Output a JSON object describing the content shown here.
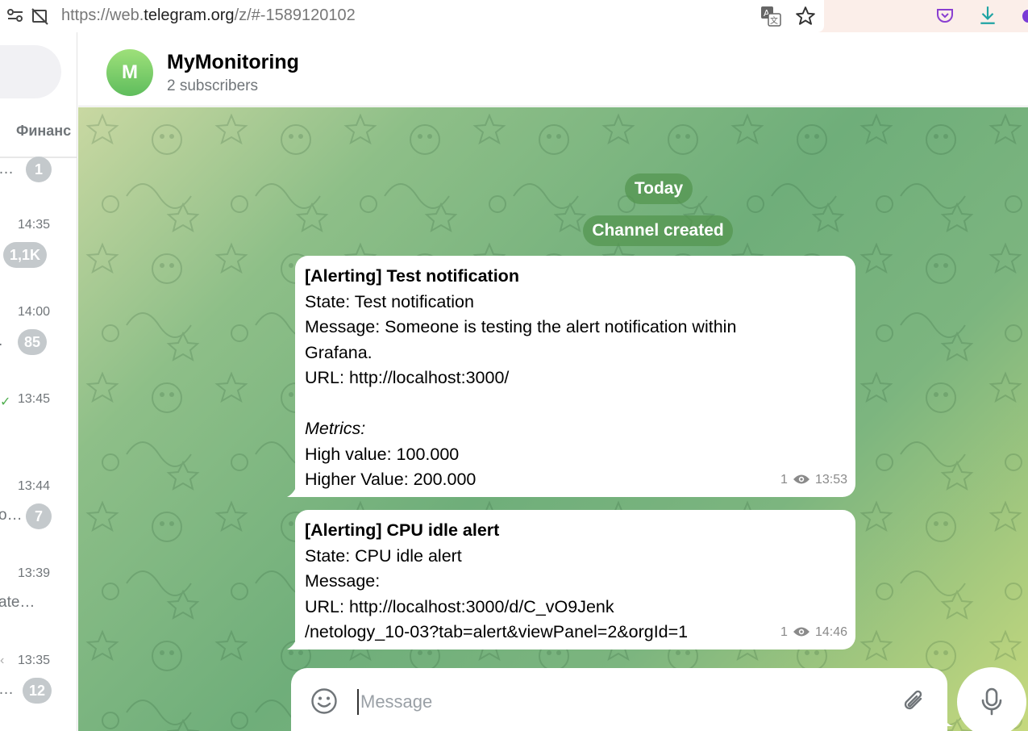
{
  "browser": {
    "url_prefix": "https://web.",
    "url_domain": "telegram.org",
    "url_path": "/z/#-1589120102"
  },
  "sidebar": {
    "folder_label": "Финанс",
    "items": [
      {
        "time": "",
        "snippet": "…",
        "badge": "1",
        "check": ""
      },
      {
        "time": "14:35",
        "snippet": "",
        "badge": "1,1K",
        "check": ""
      },
      {
        "time": "14:00",
        "snippet": ".",
        "badge": "85",
        "check": ""
      },
      {
        "time": "13:45",
        "snippet": "",
        "badge": "",
        "check": "✓"
      },
      {
        "time": "13:44",
        "snippet": "o…",
        "badge": "7",
        "check": ""
      },
      {
        "time": "13:39",
        "snippet": "ate…",
        "badge": "",
        "check": ""
      },
      {
        "time": "13:35",
        "snippet": "…",
        "badge": "12",
        "check": "‹"
      }
    ]
  },
  "header": {
    "avatar_letter": "M",
    "title": "MyMonitoring",
    "subtitle": "2 subscribers"
  },
  "chat": {
    "date_pill": "Today",
    "service_pill": "Channel created",
    "messages": [
      {
        "title": "[Alerting] Test notification",
        "lines": [
          "State: Test notification",
          "Message: Someone is testing the alert notification within",
          "Grafana.",
          "URL: http://localhost:3000/",
          "",
          "Metrics:",
          "High value: 100.000",
          "Higher Value: 200.000"
        ],
        "views": "1",
        "time": "13:53"
      },
      {
        "title": "[Alerting] CPU idle alert",
        "lines": [
          "State: CPU idle alert",
          "Message:",
          "URL: http://localhost:3000/d/C_vO9Jenk",
          "/netology_10-03?tab=alert&viewPanel=2&orgId=1"
        ],
        "views": "1",
        "time": "14:46"
      }
    ]
  },
  "composer": {
    "placeholder": "Message"
  },
  "colors": {
    "accent_green": "#5fbd5d",
    "badge_gray": "#c4c9cc",
    "pill_green": "#549650"
  }
}
